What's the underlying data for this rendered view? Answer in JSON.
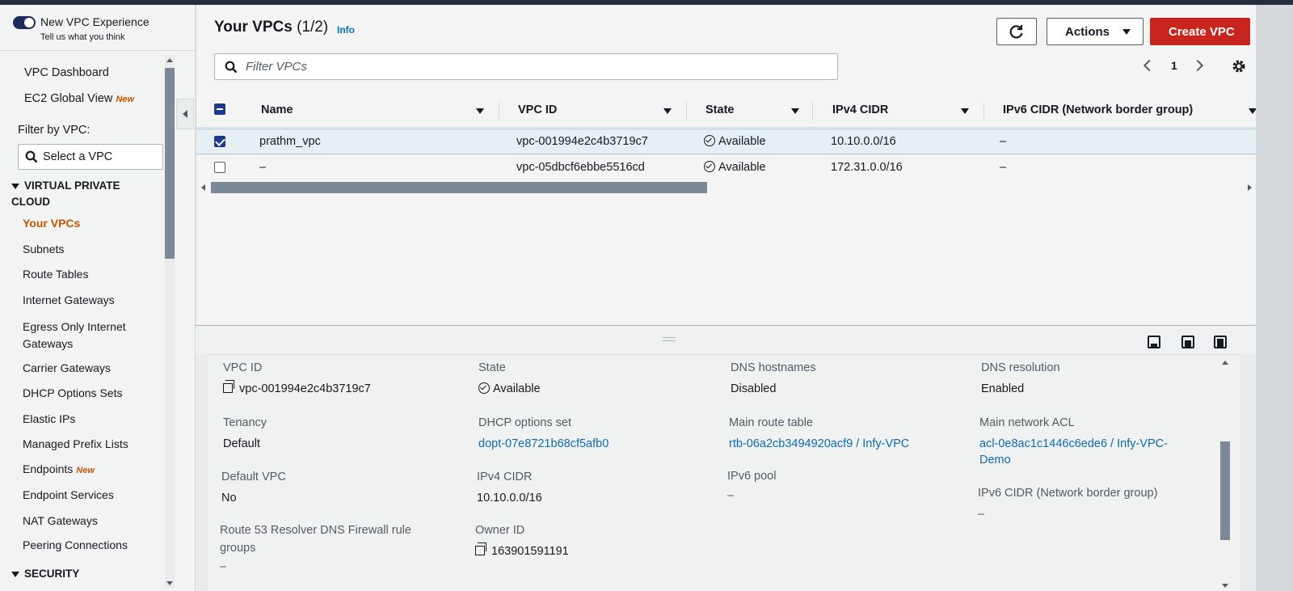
{
  "new_experience": {
    "title": "New VPC Experience",
    "subtitle": "Tell us what you think"
  },
  "sidebar": {
    "dashboard": "VPC Dashboard",
    "ec2_global": "EC2 Global View",
    "ec2_global_badge": "New",
    "filter_label": "Filter by VPC:",
    "select_placeholder": "Select a VPC",
    "section_vpc": "VIRTUAL PRIVATE CLOUD",
    "items": [
      "Your VPCs",
      "Subnets",
      "Route Tables",
      "Internet Gateways",
      "Egress Only Internet Gateways",
      "Carrier Gateways",
      "DHCP Options Sets",
      "Elastic IPs",
      "Managed Prefix Lists",
      "Endpoints",
      "Endpoint Services",
      "NAT Gateways",
      "Peering Connections"
    ],
    "endpoints_badge": "New",
    "section_security": "SECURITY"
  },
  "header": {
    "title": "Your VPCs",
    "count": "(1/2)",
    "info": "Info",
    "actions": "Actions",
    "create": "Create VPC"
  },
  "filter": {
    "placeholder": "Filter VPCs"
  },
  "pager": {
    "page": "1"
  },
  "table": {
    "columns": [
      "Name",
      "VPC ID",
      "State",
      "IPv4 CIDR",
      "IPv6 CIDR (Network border group)"
    ],
    "rows": [
      {
        "name": "prathm_vpc",
        "vpc_id": "vpc-001994e2c4b3719c7",
        "state": "Available",
        "ipv4": "10.10.0.0/16",
        "ipv6": "–",
        "selected": true
      },
      {
        "name": "–",
        "vpc_id": "vpc-05dbcf6ebbe5516cd",
        "state": "Available",
        "ipv4": "172.31.0.0/16",
        "ipv6": "–",
        "selected": false
      }
    ]
  },
  "details": {
    "vpc_id_label": "VPC ID",
    "vpc_id": "vpc-001994e2c4b3719c7",
    "state_label": "State",
    "state": "Available",
    "dns_hostnames_label": "DNS hostnames",
    "dns_hostnames": "Disabled",
    "dns_resolution_label": "DNS resolution",
    "dns_resolution": "Enabled",
    "tenancy_label": "Tenancy",
    "tenancy": "Default",
    "dhcp_label": "DHCP options set",
    "dhcp": "dopt-07e8721b68cf5afb0",
    "main_rt_label": "Main route table",
    "main_rt": "rtb-06a2cb3494920acf9 / Infy-VPC",
    "main_acl_label": "Main network ACL",
    "main_acl_line1": "acl-0e8ac1c1446c6ede6 / Infy-VPC-",
    "main_acl_line2": "Demo",
    "default_vpc_label": "Default VPC",
    "default_vpc": "No",
    "ipv4_label": "IPv4 CIDR",
    "ipv4": "10.10.0.0/16",
    "ipv6_pool_label": "IPv6 pool",
    "ipv6_pool": "–",
    "ipv6_cidr_label": "IPv6 CIDR (Network border group)",
    "ipv6_cidr": "–",
    "r53_label_line1": "Route 53 Resolver DNS Firewall rule",
    "r53_label_line2": "groups",
    "r53": "–",
    "owner_label": "Owner ID",
    "owner": "163901591191"
  },
  "colors": {
    "accent": "#c45500",
    "primary_button": "#c7251e",
    "link": "#0d6bb0",
    "checkbox": "#1d3b8a"
  }
}
